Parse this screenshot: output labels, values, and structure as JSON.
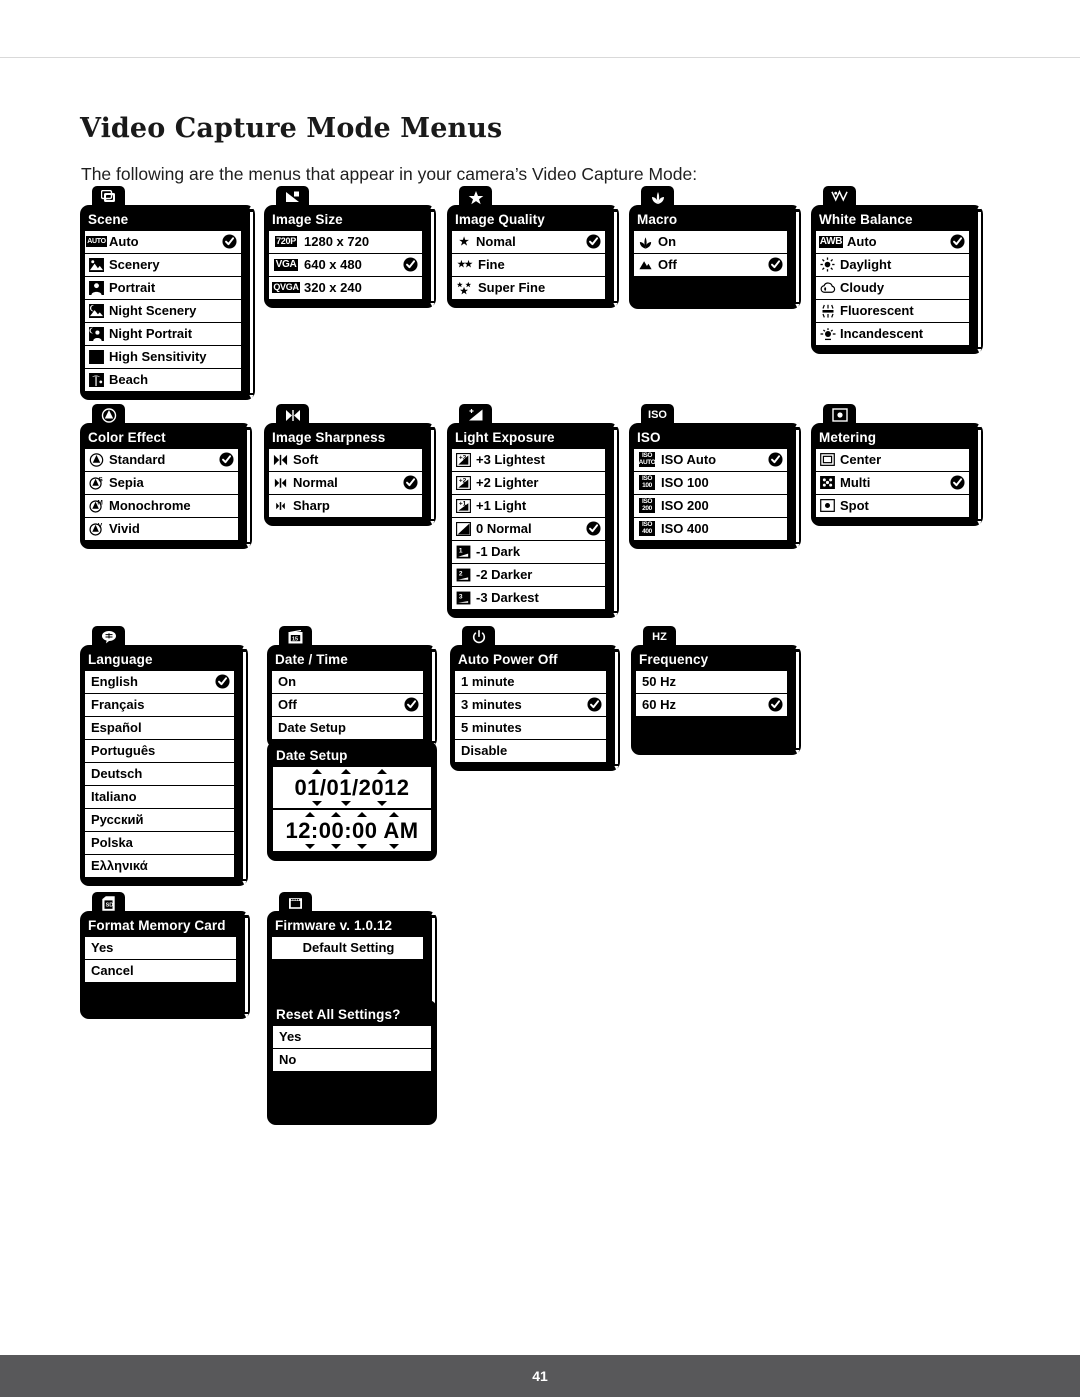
{
  "page": {
    "title": "Video Capture Mode Menus",
    "intro": "The following are the menus that appear in your camera’s Video Capture Mode:",
    "page_number": "41"
  },
  "menus": {
    "scene": {
      "tab_icon": "scene-mode-icon",
      "title": "Scene",
      "items": [
        {
          "icon": "auto-icon",
          "label": "Auto",
          "checked": true
        },
        {
          "icon": "scenery-icon",
          "label": "Scenery",
          "checked": false
        },
        {
          "icon": "portrait-icon",
          "label": "Portrait",
          "checked": false
        },
        {
          "icon": "night-scenery-icon",
          "label": "Night Scenery",
          "checked": false
        },
        {
          "icon": "night-portrait-icon",
          "label": "Night Portrait",
          "checked": false
        },
        {
          "icon": "high-sensitivity-icon",
          "label": "High Sensitivity",
          "checked": false
        },
        {
          "icon": "beach-icon",
          "label": "Beach",
          "checked": false
        }
      ]
    },
    "image_size": {
      "tab_icon": "image-size-icon",
      "title": "Image  Size",
      "items": [
        {
          "icon": "720p-badge",
          "label": "1280 x 720",
          "checked": false
        },
        {
          "icon": "vga-badge",
          "label": "640 x 480",
          "checked": true
        },
        {
          "icon": "qvga-badge",
          "label": "320 x 240",
          "checked": false
        }
      ]
    },
    "image_quality": {
      "tab_icon": "star-icon",
      "title": "Image Quality",
      "items": [
        {
          "icon": "one-star-icon",
          "label": "Nomal",
          "checked": true
        },
        {
          "icon": "two-star-icon",
          "label": "Fine",
          "checked": false
        },
        {
          "icon": "three-star-icon",
          "label": "Super Fine",
          "checked": false
        }
      ]
    },
    "macro": {
      "tab_icon": "macro-flower-icon",
      "title": "Macro",
      "items": [
        {
          "icon": "macro-flower-icon",
          "label": "On",
          "checked": false
        },
        {
          "icon": "mountain-icon",
          "label": "Off",
          "checked": true
        }
      ]
    },
    "white_balance": {
      "tab_icon": "white-balance-icon",
      "title": "White Balance",
      "items": [
        {
          "icon": "awb-badge",
          "label": "Auto",
          "checked": true
        },
        {
          "icon": "daylight-sun-icon",
          "label": "Daylight",
          "checked": false
        },
        {
          "icon": "cloudy-icon",
          "label": "Cloudy",
          "checked": false
        },
        {
          "icon": "fluorescent-icon",
          "label": "Fluorescent",
          "checked": false
        },
        {
          "icon": "incandescent-icon",
          "label": "Incandescent",
          "checked": false
        }
      ]
    },
    "color_effect": {
      "tab_icon": "color-effect-icon",
      "title": "Color Effect",
      "items": [
        {
          "icon": "color-standard-icon",
          "label": "Standard",
          "checked": true
        },
        {
          "icon": "color-sepia-icon",
          "label": "Sepia",
          "checked": false
        },
        {
          "icon": "color-monochrome-icon",
          "label": "Monochrome",
          "checked": false
        },
        {
          "icon": "color-vivid-icon",
          "label": "Vivid",
          "checked": false
        }
      ]
    },
    "image_sharpness": {
      "tab_icon": "sharpness-icon",
      "title": "Image Sharpness",
      "items": [
        {
          "icon": "sharpness-soft-icon",
          "label": "Soft",
          "checked": false
        },
        {
          "icon": "sharpness-normal-icon",
          "label": "Normal",
          "checked": true
        },
        {
          "icon": "sharpness-sharp-icon",
          "label": "Sharp",
          "checked": false
        }
      ]
    },
    "light_exposure": {
      "tab_icon": "exposure-icon",
      "title": "Light Exposure",
      "items": [
        {
          "icon": "ev-plus3-icon",
          "label": "+3 Lightest",
          "checked": false
        },
        {
          "icon": "ev-plus2-icon",
          "label": "+2 Lighter",
          "checked": false
        },
        {
          "icon": "ev-plus1-icon",
          "label": "+1 Light",
          "checked": false
        },
        {
          "icon": "ev-zero-icon",
          "label": "0 Normal",
          "checked": true
        },
        {
          "icon": "ev-minus1-icon",
          "label": "-1 Dark",
          "checked": false
        },
        {
          "icon": "ev-minus2-icon",
          "label": "-2 Darker",
          "checked": false
        },
        {
          "icon": "ev-minus3-icon",
          "label": "-3 Darkest",
          "checked": false
        }
      ]
    },
    "iso": {
      "tab_icon": "iso-icon",
      "title": "ISO",
      "items": [
        {
          "icon": "iso-auto-badge",
          "label": "ISO Auto",
          "checked": true
        },
        {
          "icon": "iso-100-badge",
          "label": "ISO 100",
          "checked": false
        },
        {
          "icon": "iso-200-badge",
          "label": "ISO 200",
          "checked": false
        },
        {
          "icon": "iso-400-badge",
          "label": "ISO 400",
          "checked": false
        }
      ]
    },
    "metering": {
      "tab_icon": "metering-icon",
      "title": "Metering",
      "items": [
        {
          "icon": "metering-center-icon",
          "label": "Center",
          "checked": false
        },
        {
          "icon": "metering-multi-icon",
          "label": "Multi",
          "checked": true
        },
        {
          "icon": "metering-spot-icon",
          "label": "Spot",
          "checked": false
        }
      ]
    },
    "language": {
      "tab_icon": "language-icon",
      "title": "Language",
      "items": [
        {
          "label": "English",
          "checked": true
        },
        {
          "label": "Français",
          "checked": false
        },
        {
          "label": "Español",
          "checked": false
        },
        {
          "label": "Português",
          "checked": false
        },
        {
          "label": "Deutsch",
          "checked": false
        },
        {
          "label": "Italiano",
          "checked": false
        },
        {
          "label": "Русский",
          "checked": false
        },
        {
          "label": "Polska",
          "checked": false
        },
        {
          "label": "Ελληνικά",
          "checked": false
        }
      ]
    },
    "date_time": {
      "tab_icon": "calendar-icon",
      "title": "Date / Time",
      "items": [
        {
          "label": "On",
          "checked": false
        },
        {
          "label": "Off",
          "checked": true
        },
        {
          "label": "Date Setup",
          "checked": false
        }
      ]
    },
    "date_setup": {
      "title": "Date Setup",
      "date_value": "01/01/2012",
      "time_value": "12:00:00 AM"
    },
    "auto_power_off": {
      "tab_icon": "power-icon",
      "title": "Auto Power Off",
      "items": [
        {
          "label": "1 minute",
          "checked": false
        },
        {
          "label": "3 minutes",
          "checked": true
        },
        {
          "label": "5 minutes",
          "checked": false
        },
        {
          "label": "Disable",
          "checked": false
        }
      ]
    },
    "frequency": {
      "tab_icon": "hz-icon",
      "title": "Frequency",
      "items": [
        {
          "label": "50 Hz",
          "checked": false
        },
        {
          "label": "60 Hz",
          "checked": true
        }
      ]
    },
    "format_memory_card": {
      "tab_icon": "sd-card-icon",
      "title": "Format Memory Card",
      "items": [
        {
          "label": "Yes",
          "checked": false
        },
        {
          "label": "Cancel",
          "checked": false
        }
      ]
    },
    "firmware": {
      "tab_icon": "firmware-icon",
      "title": "Firmware v. 1.0.12",
      "items": [
        {
          "label": "Default Setting",
          "checked": false
        }
      ]
    },
    "reset_all": {
      "title": "Reset All Settings?",
      "items": [
        {
          "label": "Yes",
          "checked": false
        },
        {
          "label": "No",
          "checked": false
        }
      ]
    }
  },
  "colors": {
    "menu_bg": "#000000",
    "row_bg": "#ffffff",
    "footer_bg": "#58585a",
    "text": "#1a1a1a"
  }
}
